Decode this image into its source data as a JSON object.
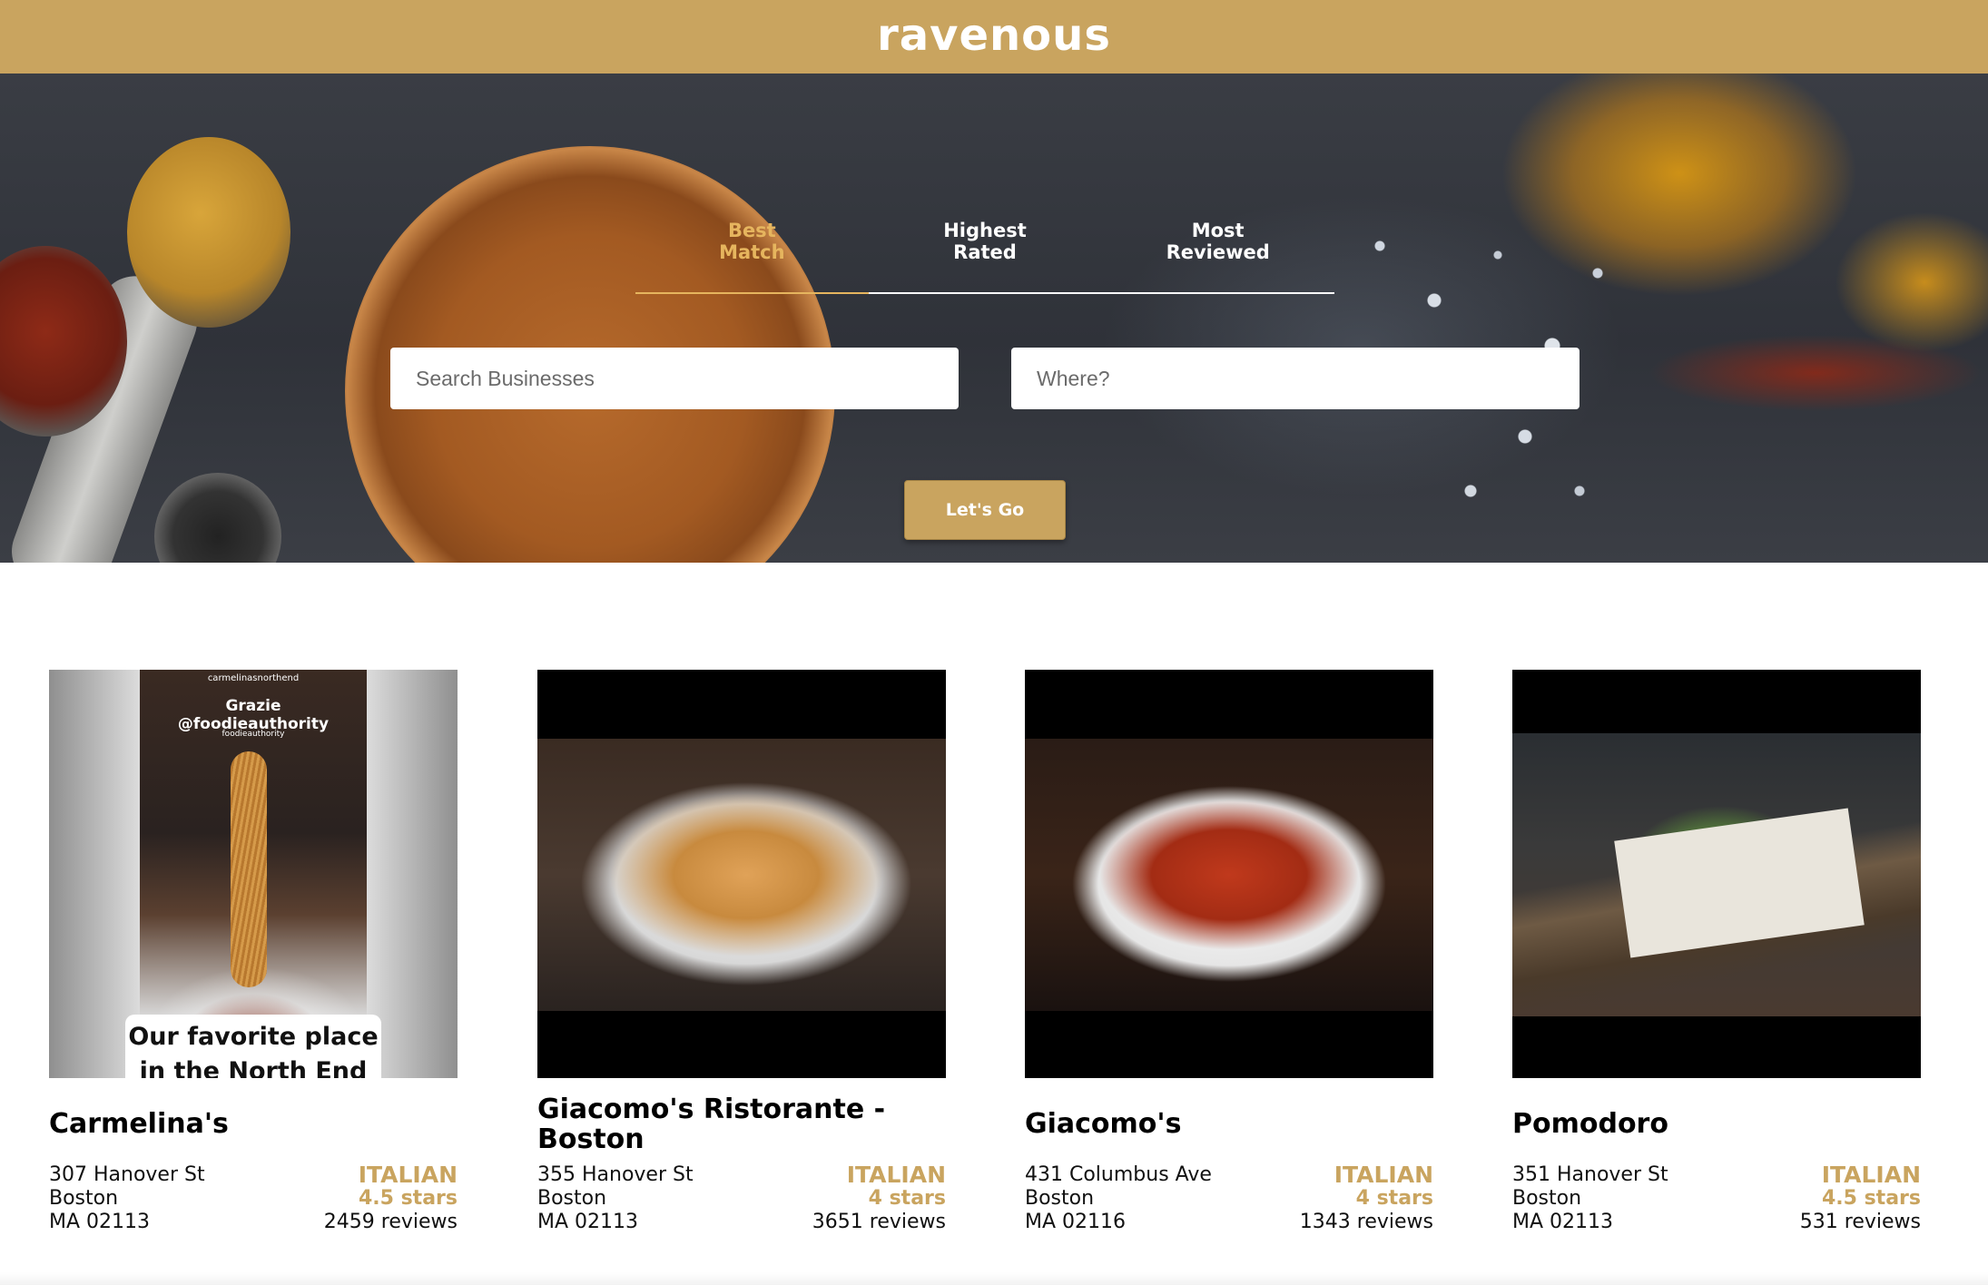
{
  "header": {
    "logo": "ravenous"
  },
  "sort_tabs": [
    {
      "label": "Best\nMatch",
      "active": true
    },
    {
      "label": "Highest\nRated",
      "active": false
    },
    {
      "label": "Most\nReviewed",
      "active": false
    }
  ],
  "search": {
    "term_placeholder": "Search Businesses",
    "location_placeholder": "Where?",
    "submit_label": "Let's Go"
  },
  "businesses": [
    {
      "name": "Carmelina's",
      "address": "307 Hanover St",
      "city": "Boston",
      "state_zip": "MA 02113",
      "category": "ITALIAN",
      "rating": "4.5 stars",
      "reviews": "2459 reviews",
      "image_caption_top": "Grazie @foodieauthority",
      "image_caption_box": "Our favorite place in the North End",
      "image_account": "carmelinasnorthend",
      "image_account_2": "foodieauthority"
    },
    {
      "name": "Giacomo's Ristorante - Boston",
      "address": "355 Hanover St",
      "city": "Boston",
      "state_zip": "MA 02113",
      "category": "ITALIAN",
      "rating": "4 stars",
      "reviews": "3651 reviews"
    },
    {
      "name": "Giacomo's",
      "address": "431 Columbus Ave",
      "city": "Boston",
      "state_zip": "MA 02116",
      "category": "ITALIAN",
      "rating": "4 stars",
      "reviews": "1343 reviews"
    },
    {
      "name": "Pomodoro",
      "address": "351 Hanover St",
      "city": "Boston",
      "state_zip": "MA 02113",
      "category": "ITALIAN",
      "rating": "4.5 stars",
      "reviews": "531 reviews"
    }
  ],
  "colors": {
    "brand": "#c9a45f",
    "active_tab": "#e6b55e"
  }
}
